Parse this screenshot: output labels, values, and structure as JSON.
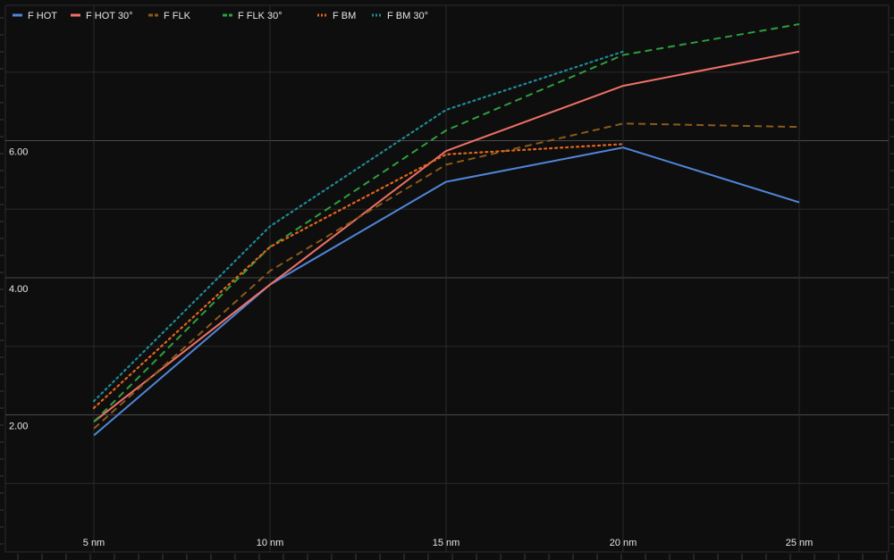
{
  "chart_data": {
    "type": "line",
    "x": [
      "5 nm",
      "10 nm",
      "15 nm",
      "20 nm",
      "25 nm"
    ],
    "yticks": [
      "2.00",
      "4.00",
      "6.00"
    ],
    "ylim": [
      0,
      8
    ],
    "grid": true,
    "legend_position": "top-left",
    "series": [
      {
        "name": "F HOT",
        "color": "#4f86d8",
        "dash": "solid",
        "values": [
          1.7,
          3.9,
          5.4,
          5.9,
          5.1
        ]
      },
      {
        "name": "F HOT 30°",
        "color": "#f07167",
        "dash": "solid",
        "values": [
          1.9,
          3.9,
          5.85,
          6.8,
          7.3
        ]
      },
      {
        "name": "F FLK",
        "color": "#8a5a1a",
        "dash": "dashed",
        "values": [
          1.8,
          4.1,
          5.65,
          6.25,
          6.2
        ]
      },
      {
        "name": "F FLK 30°",
        "color": "#2e9e3e",
        "dash": "dashed",
        "values": [
          1.9,
          4.45,
          6.15,
          7.25,
          7.7
        ]
      },
      {
        "name": "F BM",
        "color": "#e2651b",
        "dash": "dotted",
        "values": [
          2.1,
          4.45,
          5.8,
          5.95,
          null
        ]
      },
      {
        "name": "F BM 30°",
        "color": "#1f8a96",
        "dash": "dotted",
        "values": [
          2.2,
          4.75,
          6.45,
          7.3,
          null
        ]
      }
    ]
  }
}
